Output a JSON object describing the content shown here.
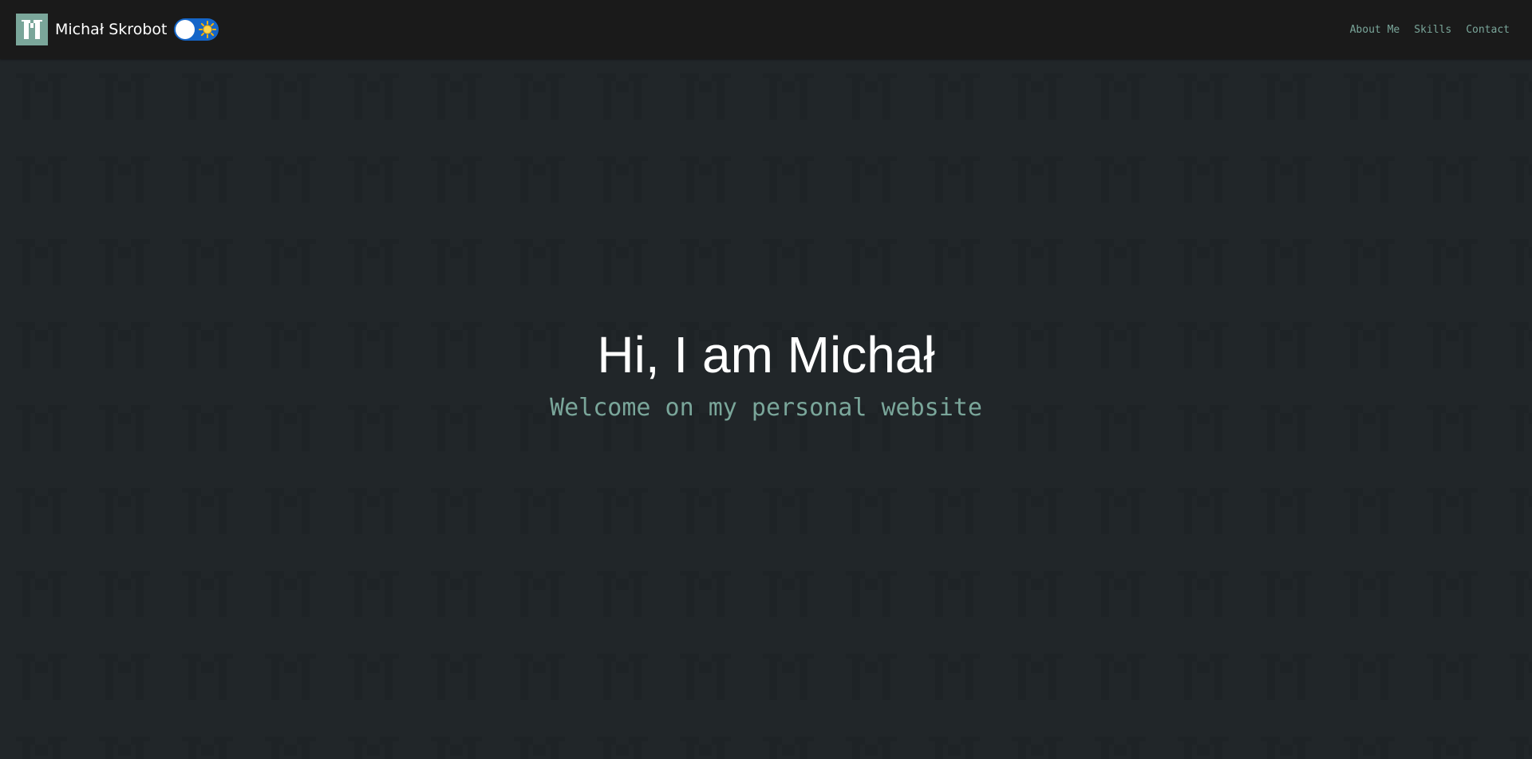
{
  "navbar": {
    "brand_name": "Michał Skrobot",
    "logo_icon": "pixel-m-logo-icon",
    "theme_toggle_icon": "sun-icon",
    "links": [
      {
        "label": "About Me"
      },
      {
        "label": "Skills"
      },
      {
        "label": "Contact"
      }
    ]
  },
  "hero": {
    "title": "Hi, I am Michał",
    "subtitle": "Welcome on my personal website",
    "background_pattern_icon": "m-letter-pattern"
  },
  "colors": {
    "navbar_bg": "#1a1a1a",
    "page_bg": "#212629",
    "accent": "#7aa69a",
    "toggle_bg": "#1566c8",
    "title": "#ffffff"
  }
}
